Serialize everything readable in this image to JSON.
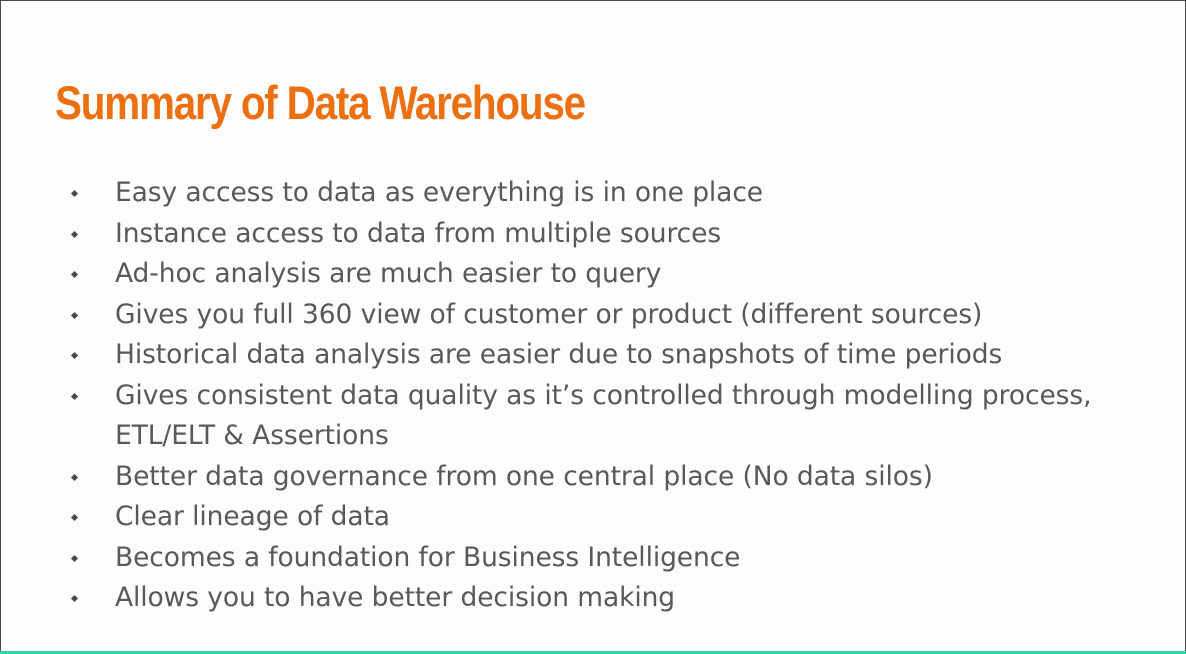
{
  "slide": {
    "title": "Summary of Data Warehouse",
    "bullets": [
      {
        "text": "Easy access to data as everything is in one place"
      },
      {
        "text": "Instance access to data from multiple sources"
      },
      {
        "text": "Ad-hoc analysis are much easier to query"
      },
      {
        "text": "Gives you full 360 view of customer or product (different sources)"
      },
      {
        "text": "Historical data analysis are easier due to snapshots of time periods"
      },
      {
        "text": "Gives consistent data quality as it’s controlled through modelling process, ETL/ELT & Assertions"
      },
      {
        "text": "Better data governance from one central place (No data silos)"
      },
      {
        "text": "Clear lineage of data"
      },
      {
        "text": "Becomes a foundation for Business Intelligence"
      },
      {
        "text": "Allows you to have better decision making"
      }
    ]
  },
  "colors": {
    "title": "#ec6f10",
    "body_text": "#595959",
    "background": "#fdfdfd",
    "bottom_accent": "#2fd6a8"
  },
  "icons": {
    "bullet": "diamond-bullet-icon"
  }
}
